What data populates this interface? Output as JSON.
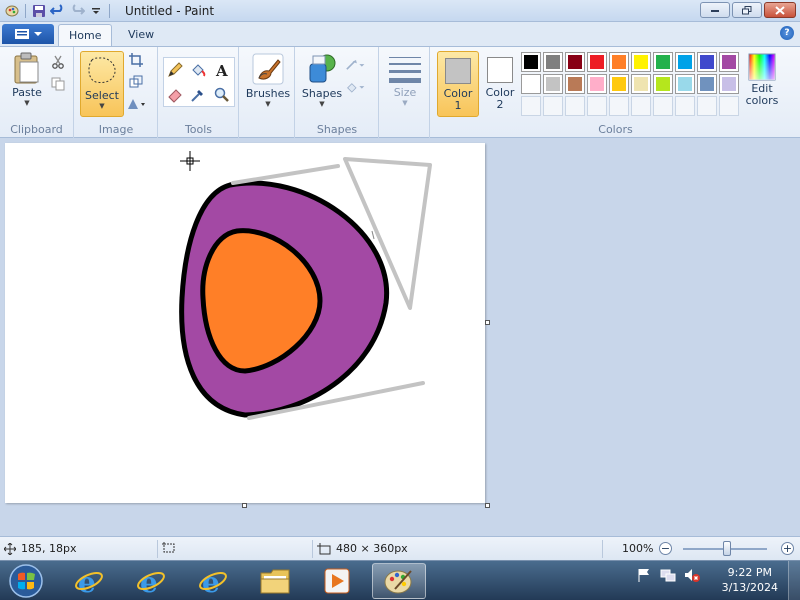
{
  "window": {
    "title": "Untitled - Paint"
  },
  "tabs": [
    {
      "label": "Home"
    },
    {
      "label": "View"
    }
  ],
  "ribbon": {
    "clipboard": {
      "paste_label": "Paste",
      "group_label": "Clipboard"
    },
    "image": {
      "select_label": "Select",
      "group_label": "Image"
    },
    "tools": {
      "group_label": "Tools"
    },
    "brushes": {
      "label": "Brushes"
    },
    "shapes": {
      "label": "Shapes",
      "group_label": "Shapes"
    },
    "size": {
      "label": "Size"
    },
    "colors": {
      "color1_label": "Color",
      "color1_num": "1",
      "color2_label": "Color",
      "color2_num": "2",
      "color1_value": "#c3c3c3",
      "color2_value": "#ffffff",
      "edit_label": "Edit",
      "edit_label2": "colors",
      "group_label": "Colors",
      "palette_row1": [
        "#000000",
        "#7f7f7f",
        "#880015",
        "#ed1c24",
        "#ff7f27",
        "#fff200",
        "#22b14c",
        "#00a2e8",
        "#3f48cc",
        "#a349a4"
      ],
      "palette_row2": [
        "#ffffff",
        "#c3c3c3",
        "#b97a57",
        "#ffaec9",
        "#ffc90e",
        "#efe4b0",
        "#b5e61d",
        "#99d9ea",
        "#7092be",
        "#c8bfe7"
      ]
    }
  },
  "canvas": {
    "fill_outer": "#a349a4",
    "fill_inner": "#ff7f27"
  },
  "status": {
    "cursor_pos": "185, 18px",
    "canvas_size": "480 × 360px",
    "zoom": "100%",
    "zoom_minus": "−",
    "zoom_plus": "+"
  },
  "taskbar": {
    "time": "9:22 PM",
    "date": "3/13/2024"
  }
}
